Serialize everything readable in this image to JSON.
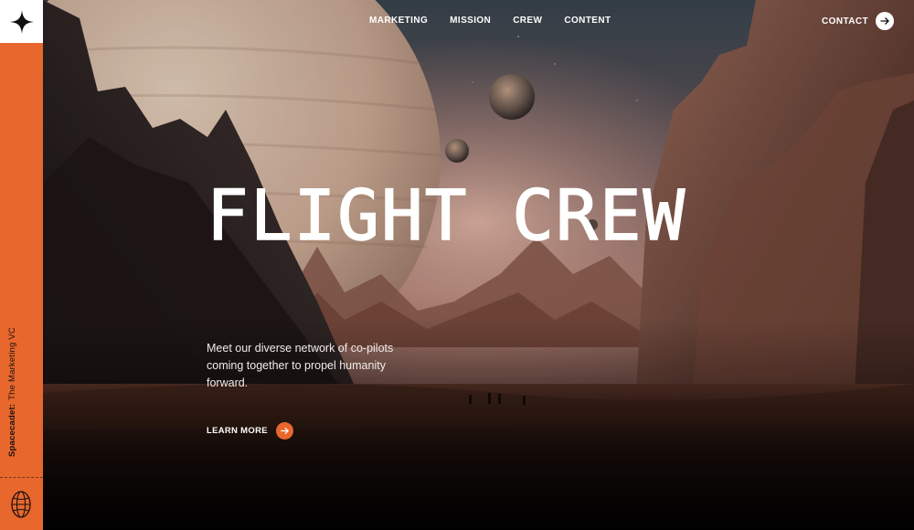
{
  "brand": {
    "vertical_label_bold": "Spacecadet:",
    "vertical_label": "The Marketing VC",
    "accent_color": "#e8672d",
    "logo_icon": "four-point-star-icon",
    "badge_icon": "globe-icon"
  },
  "nav": {
    "items": [
      {
        "label": "MARKETING"
      },
      {
        "label": "MISSION"
      },
      {
        "label": "CREW"
      },
      {
        "label": "CONTENT"
      }
    ],
    "contact_label": "CONTACT",
    "contact_icon": "arrow-right-icon"
  },
  "hero": {
    "title": "FLIGHT CREW",
    "description": "Meet our diverse network of co-pilots coming together to propel humanity forward.",
    "cta_label": "LEARN MORE",
    "cta_icon": "arrow-right-icon"
  }
}
